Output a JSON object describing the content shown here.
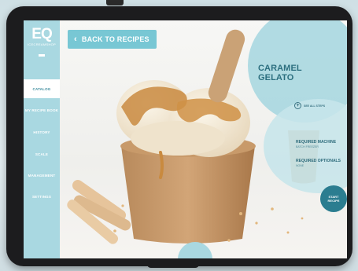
{
  "app": {
    "logo_mark": "EQ",
    "logo_sub": "ICECREAMSHOP"
  },
  "sidebar": {
    "items": [
      {
        "label": "CATALOG",
        "active": true
      },
      {
        "label": "MY RECIPE BOOK",
        "active": false
      },
      {
        "label": "HISTORY",
        "active": false
      },
      {
        "label": "SCALE",
        "active": false
      },
      {
        "label": "MANAGEMENT",
        "active": false
      },
      {
        "label": "SETTINGS",
        "active": false
      }
    ]
  },
  "header": {
    "back_label": "BACK TO RECIPES",
    "back_icon": "chevron-left-icon"
  },
  "recipe": {
    "title": "CARAMEL GELATO",
    "see_all_label": "SEE ALL STEPS",
    "required_machine_label": "REQUIRED MACHINE",
    "required_machine_value": "BATCH FREEZER",
    "required_optionals_label": "REQUIRED OPTIONALS",
    "required_optionals_value": "NONE"
  },
  "actions": {
    "start_label_1": "START",
    "start_label_2": "RECIPE"
  },
  "colors": {
    "accent": "#78c7d4",
    "sidebar": "#a9d8e1",
    "dark_teal": "#2b7d90",
    "bezel": "#1c1c1e"
  }
}
